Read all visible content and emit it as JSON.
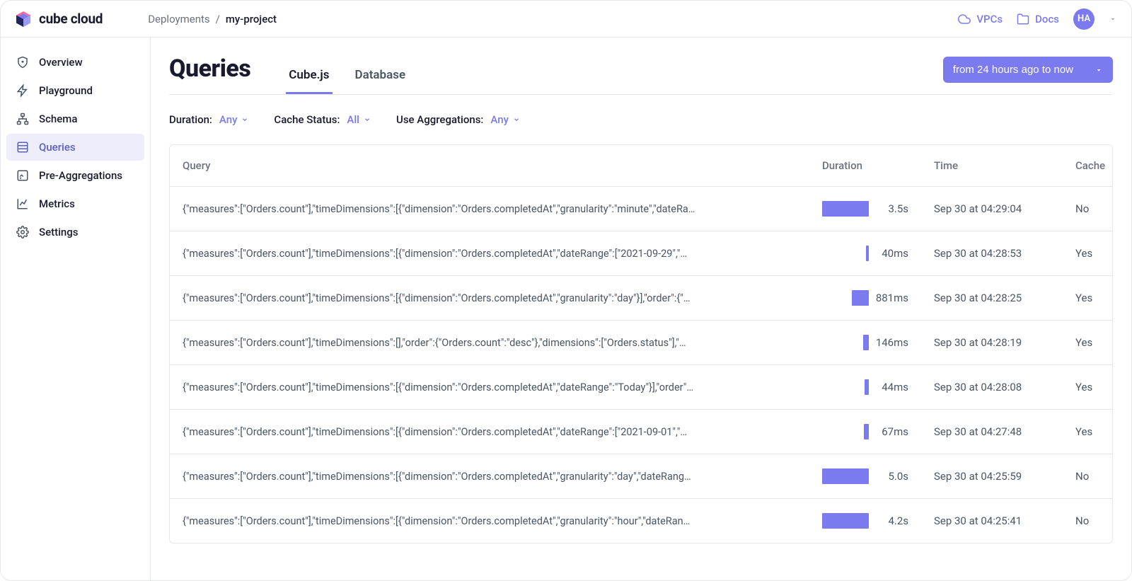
{
  "brand": "cube cloud",
  "breadcrumb": {
    "root": "Deployments",
    "current": "my-project"
  },
  "topnav": {
    "vpcs": "VPCs",
    "docs": "Docs",
    "avatar": "HA"
  },
  "sidebar": {
    "items": [
      {
        "label": "Overview",
        "icon": "shield"
      },
      {
        "label": "Playground",
        "icon": "bolt"
      },
      {
        "label": "Schema",
        "icon": "schema"
      },
      {
        "label": "Queries",
        "icon": "queries",
        "active": true
      },
      {
        "label": "Pre-Aggregations",
        "icon": "preagg"
      },
      {
        "label": "Metrics",
        "icon": "metrics"
      },
      {
        "label": "Settings",
        "icon": "gear"
      }
    ]
  },
  "page": {
    "title": "Queries",
    "tabs": [
      {
        "label": "Cube.js",
        "active": true
      },
      {
        "label": "Database"
      }
    ],
    "time_range": "from 24 hours ago to now"
  },
  "filters": {
    "duration_label": "Duration:",
    "duration_value": "Any",
    "cache_label": "Cache Status:",
    "cache_value": "All",
    "agg_label": "Use Aggregations:",
    "agg_value": "Any"
  },
  "table": {
    "headers": {
      "query": "Query",
      "duration": "Duration",
      "time": "Time",
      "cache": "Cache"
    },
    "rows": [
      {
        "query": "{\"measures\":[\"Orders.count\"],\"timeDimensions\":[{\"dimension\":\"Orders.completedAt\",\"granularity\":\"minute\",\"dateRa…",
        "duration": "3.5s",
        "bar": 70,
        "time": "Sep 30 at 04:29:04",
        "cache": "No"
      },
      {
        "query": "{\"measures\":[\"Orders.count\"],\"timeDimensions\":[{\"dimension\":\"Orders.completedAt\",\"dateRange\":[\"2021-09-29\",\"…",
        "duration": "40ms",
        "bar": 4,
        "time": "Sep 30 at 04:28:53",
        "cache": "Yes"
      },
      {
        "query": "{\"measures\":[\"Orders.count\"],\"timeDimensions\":[{\"dimension\":\"Orders.completedAt\",\"granularity\":\"day\"}],\"order\":{\"…",
        "duration": "881ms",
        "bar": 24,
        "time": "Sep 30 at 04:28:25",
        "cache": "Yes"
      },
      {
        "query": "{\"measures\":[\"Orders.count\"],\"timeDimensions\":[],\"order\":{\"Orders.count\":\"desc\"},\"dimensions\":[\"Orders.status\"],\"…",
        "duration": "146ms",
        "bar": 8,
        "time": "Sep 30 at 04:28:19",
        "cache": "Yes"
      },
      {
        "query": "{\"measures\":[\"Orders.count\"],\"timeDimensions\":[{\"dimension\":\"Orders.completedAt\",\"dateRange\":\"Today\"}],\"order\"…",
        "duration": "44ms",
        "bar": 6,
        "time": "Sep 30 at 04:28:08",
        "cache": "Yes"
      },
      {
        "query": "{\"measures\":[\"Orders.count\"],\"timeDimensions\":[{\"dimension\":\"Orders.completedAt\",\"dateRange\":[\"2021-09-01\",\"…",
        "duration": "67ms",
        "bar": 7,
        "time": "Sep 30 at 04:27:48",
        "cache": "Yes"
      },
      {
        "query": "{\"measures\":[\"Orders.count\"],\"timeDimensions\":[{\"dimension\":\"Orders.completedAt\",\"granularity\":\"day\",\"dateRang…",
        "duration": "5.0s",
        "bar": 82,
        "time": "Sep 30 at 04:25:59",
        "cache": "No"
      },
      {
        "query": "{\"measures\":[\"Orders.count\"],\"timeDimensions\":[{\"dimension\":\"Orders.completedAt\",\"granularity\":\"hour\",\"dateRan…",
        "duration": "4.2s",
        "bar": 78,
        "time": "Sep 30 at 04:25:41",
        "cache": "No"
      }
    ]
  }
}
